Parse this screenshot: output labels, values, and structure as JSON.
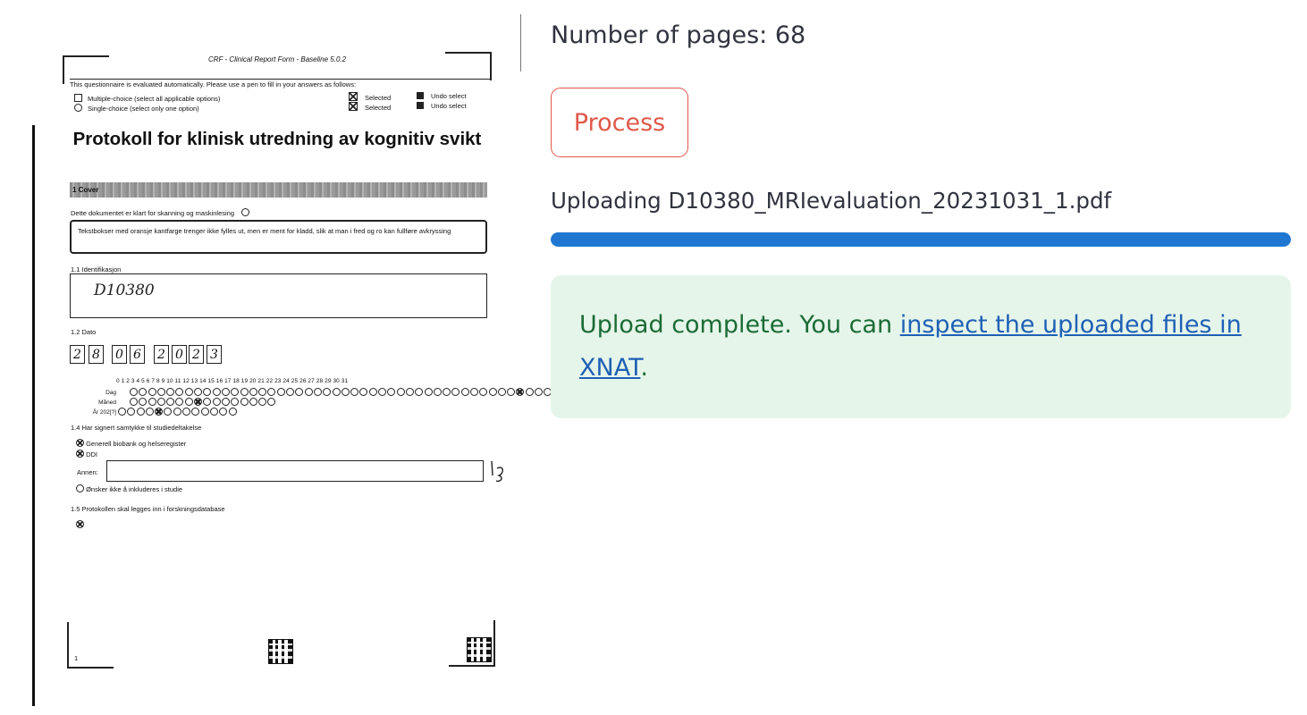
{
  "preview": {
    "header": "CRF - Clinical Report Form - Baseline 5.0.2",
    "instructions": "This questionnaire is evaluated automatically. Please use a pen to fill in your answers as follows:",
    "legend_multi": "Multiple-choice (select all applicable options)",
    "legend_single": "Single-choice (select only one option)",
    "selected": "Selected",
    "undo": "Undo select",
    "title": "Protokoll for klinisk utredning av kognitiv svikt",
    "section": "1 Cover",
    "ready_text": "Dette dokumentet er klart for skanning og maskinlesing",
    "info_text": "Tekstbokser med oransje kantfarge trenger ikke fylles ut, men er ment for kladd, slik at man i fred og ro kan fullføre avkryssing",
    "q_identifikasjon": "1.1 Identifikasjon",
    "id_handwritten": "D10380",
    "q_dato": "1.2 Dato",
    "date_digits": [
      "2",
      "8",
      "0",
      "6",
      "2",
      "0",
      "2",
      "3"
    ],
    "day_numbers": "0 1 2 3 4 5 6 7 8 9 10 11 12 13 14 15 16 17 18 19 20 21 22 23 24 25 26 27 28 29 30 31",
    "row_dag": "Dag",
    "row_maned": "Måned",
    "row_ar": "År 202[?]",
    "q_samtykke": "1.4 Har signert samtykke til studiedeltakelse",
    "opt_biobank": "Generell biobank og helseregister",
    "opt_ddi": "DDI",
    "opt_annen": "Annen:",
    "opt_onsker": "Ønsker ikke å inkluderes i studie",
    "q_protokoll": "1.5 Protokollen skal legges inn i forskningsdatabase",
    "page_number": "1"
  },
  "panel": {
    "pages_count": "Number of pages: 68",
    "process_label": "Process",
    "upload_status": "Uploading D10380_MRIevaluation_20231031_1.pdf",
    "progress_percent": 100,
    "alert_prefix": "Upload complete. You can ",
    "alert_link": "inspect the uploaded files in XNAT",
    "alert_suffix": "."
  },
  "colors": {
    "process_accent": "#e0584a",
    "progress_fill": "#1f77d2",
    "success_bg": "#e5f5ea",
    "success_text": "#1b6b35",
    "link": "#1f60b5"
  }
}
